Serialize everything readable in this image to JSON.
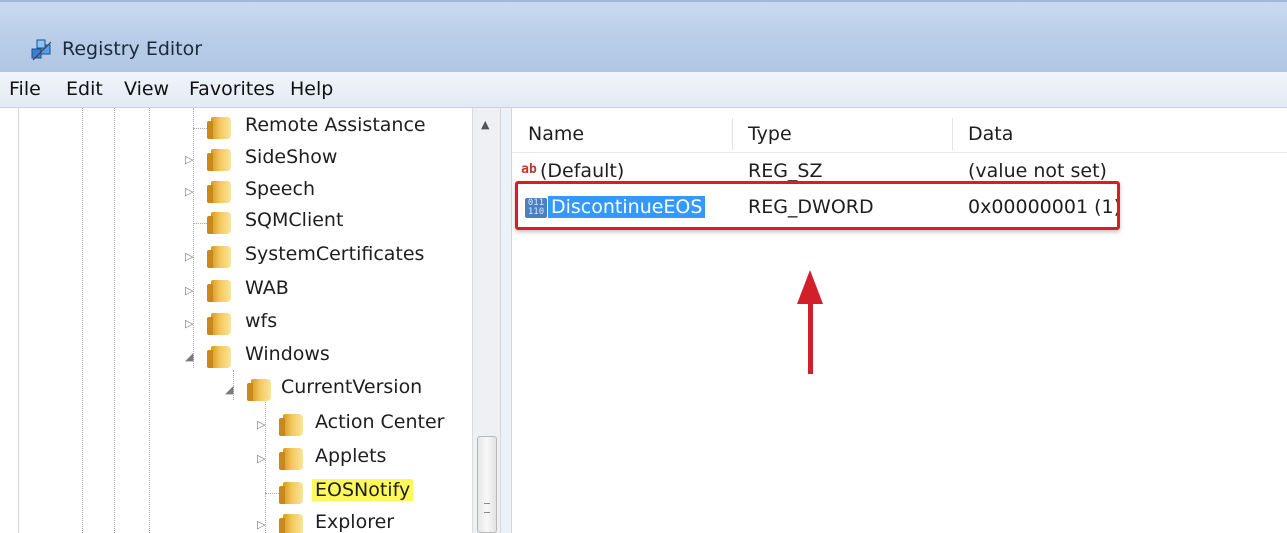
{
  "window": {
    "title": "Registry Editor",
    "icon": "registry-cubes-icon"
  },
  "menu": {
    "items": [
      {
        "label": "File"
      },
      {
        "label": "Edit"
      },
      {
        "label": "View"
      },
      {
        "label": "Favorites"
      },
      {
        "label": "Help"
      }
    ]
  },
  "tree": {
    "nodes": [
      {
        "label": "Remote Assistance",
        "expander": ""
      },
      {
        "label": "SideShow",
        "expander": "▷"
      },
      {
        "label": "Speech",
        "expander": "▷"
      },
      {
        "label": "SQMClient",
        "expander": ""
      },
      {
        "label": "SystemCertificates",
        "expander": "▷"
      },
      {
        "label": "WAB",
        "expander": "▷"
      },
      {
        "label": "wfs",
        "expander": "▷"
      },
      {
        "label": "Windows",
        "expander": "◢"
      },
      {
        "label": "CurrentVersion",
        "expander": "◢"
      },
      {
        "label": "Action Center",
        "expander": "▷"
      },
      {
        "label": "Applets",
        "expander": "▷"
      },
      {
        "label": "EOSNotify",
        "expander": "",
        "selected": true
      },
      {
        "label": "Explorer",
        "expander": "▷"
      }
    ]
  },
  "scrollbar": {
    "up_glyph": "▲"
  },
  "list": {
    "columns": [
      {
        "label": "Name"
      },
      {
        "label": "Type"
      },
      {
        "label": "Data"
      }
    ],
    "rows": [
      {
        "icon": "string-value-icon",
        "icon_glyph": "ab",
        "name": "(Default)",
        "type": "REG_SZ",
        "data": "(value not set)"
      },
      {
        "icon": "dword-value-icon",
        "icon_glyph": "011 110",
        "name": "DiscontinueEOS",
        "type": "REG_DWORD",
        "data": "0x00000001 (1)",
        "selected": true
      }
    ]
  },
  "annotation": {
    "highlight_color": "#d1202a",
    "tree_selection_color": "#fef95a",
    "list_selection_color": "#3399ff"
  }
}
